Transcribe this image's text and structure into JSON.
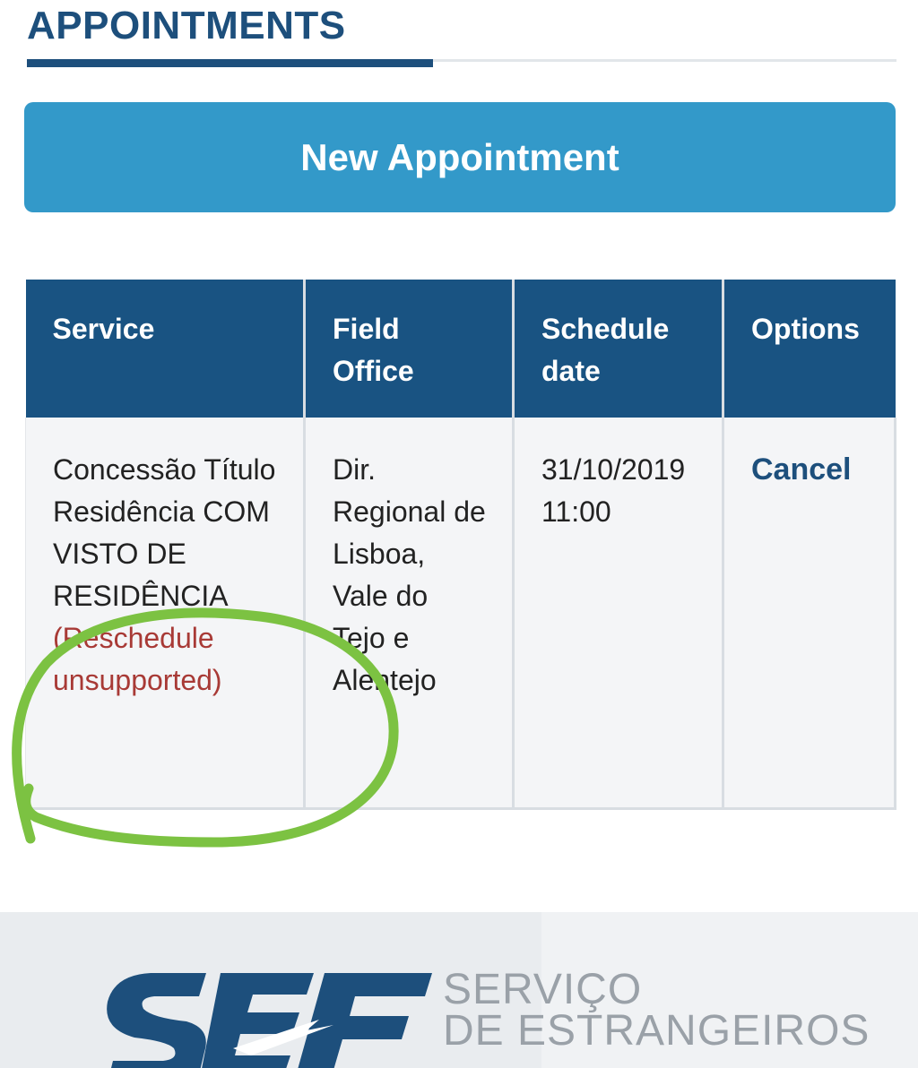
{
  "header": {
    "title": "APPOINTMENTS"
  },
  "actions": {
    "new_appointment_label": "New Appointment"
  },
  "table": {
    "columns": {
      "service": "Service",
      "field_office": "Field Office",
      "schedule_date": "Schedule date",
      "options": "Options"
    },
    "rows": [
      {
        "service": "Concessão Título Residência COM VISTO DE RESIDÊNCIA",
        "service_note": "(Reschedule unsupported)",
        "field_office": "Dir. Regional de Lisboa, Vale do Tejo e Alentejo",
        "schedule_date": "31/10/2019 11:00",
        "option_label": "Cancel"
      }
    ]
  },
  "annotation": {
    "shape": "hand-drawn-circle",
    "color": "#7cc242"
  },
  "footer": {
    "logo_letters": "SEF",
    "brand_line1": "SERVIÇO",
    "brand_line2": "DE ESTRANGEIROS"
  },
  "colors": {
    "brand_dark": "#1d4f7c",
    "button_blue": "#3399c9",
    "table_header": "#195382",
    "note_red": "#a83a36"
  }
}
